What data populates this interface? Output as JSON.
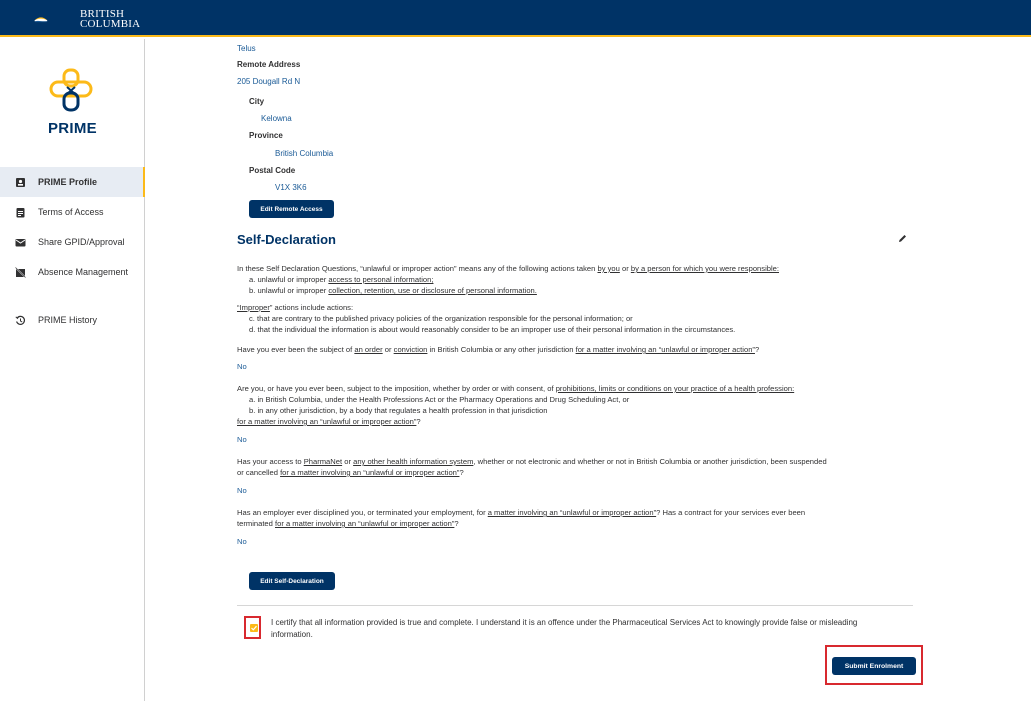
{
  "header": {
    "brand_line1": "BRITISH",
    "brand_line2": "COLUMBIA"
  },
  "sidebar": {
    "title": "PRIME",
    "items": [
      {
        "label": "PRIME Profile",
        "icon": "profile-badge-icon",
        "active": true
      },
      {
        "label": "Terms of Access",
        "icon": "document-icon"
      },
      {
        "label": "Share GPID/Approval",
        "icon": "mail-icon"
      },
      {
        "label": "Absence Management",
        "icon": "absence-icon"
      },
      {
        "label": "PRIME History",
        "icon": "history-icon"
      }
    ]
  },
  "remote": {
    "vendor_value": "Telus",
    "address_label": "Remote Address",
    "address_value": "205 Dougall Rd N",
    "city_label": "City",
    "city_value": "Kelowna",
    "province_label": "Province",
    "province_value": "British Columbia",
    "postal_label": "Postal Code",
    "postal_value": "V1X 3K6",
    "edit_button": "Edit Remote Access"
  },
  "self_declaration": {
    "title": "Self-Declaration",
    "intro_pre": "In these Self Declaration Questions, “unlawful or improper action” means any of the following actions taken ",
    "intro_link1": "by you",
    "intro_mid": " or ",
    "intro_link2": "by a person for which you were responsible:",
    "item_a_pre": "a. unlawful or improper ",
    "item_a_link": "access to personal information;",
    "item_b_pre": "b. unlawful or improper ",
    "item_b_link": "collection, retention, use or disclosure of personal information.",
    "improper_link": "“Improper",
    "improper_rest": "” actions include actions:",
    "item_c": "c. that are contrary to the published privacy policies of the organization responsible for the personal information; or",
    "item_d": "d. that the individual the information is about would reasonably consider to be an improper use of their personal information in the circumstances.",
    "q1_pre": "Have you ever been the subject of ",
    "q1_link1": "an order",
    "q1_or": " or ",
    "q1_link2": "conviction",
    "q1_mid": " in British Columbia or any other jurisdiction ",
    "q1_link3": "for a matter involving an “unlawful or improper action”",
    "q1_end": "?",
    "q1_answer": "No",
    "q2_pre": "Are you, or have you ever been, subject to the imposition, whether by order or with consent, of ",
    "q2_link": "prohibitions, limits or conditions on your practice of a health profession:",
    "q2_a": "a. in British Columbia, under the Health Professions Act or the Pharmacy Operations and Drug Scheduling Act, or",
    "q2_b": "b. in any other jurisdiction, by a body that regulates a health profession in that jurisdiction",
    "q2_link2": "for a matter involving an “unlawful or improper action”",
    "q2_end": "?",
    "q2_answer": "No",
    "q3_pre": "Has your access to ",
    "q3_link1": "PharmaNet",
    "q3_or": " or ",
    "q3_link2": "any other health information system",
    "q3_mid": ", whether or not electronic and whether or not in British Columbia or another jurisdiction, been suspended",
    "q3_line2_pre": "or cancelled ",
    "q3_link3": "for a matter involving an “unlawful or improper action”",
    "q3_end": "?",
    "q3_answer": "No",
    "q4_pre": "Has an employer ever disciplined you, or terminated your employment, for ",
    "q4_link1": "a matter involving an “unlawful or improper action”",
    "q4_mid": "? Has a contract for your services ever been",
    "q4_line2_pre": "terminated ",
    "q4_link2": "for a matter involving an “unlawful or improper action”",
    "q4_end": "?",
    "q4_answer": "No",
    "edit_button": "Edit Self-Declaration"
  },
  "certify": {
    "checked": true,
    "line1": "I certify that all information provided is true and complete. I understand it is an offence under the Pharmaceutical Services Act to knowingly provide false or misleading",
    "line2": "information."
  },
  "submit_button": "Submit Enrolment",
  "colors": {
    "navy": "#003366",
    "gold": "#fcba19",
    "link": "#1a5a96",
    "highlight": "#d8292f"
  }
}
